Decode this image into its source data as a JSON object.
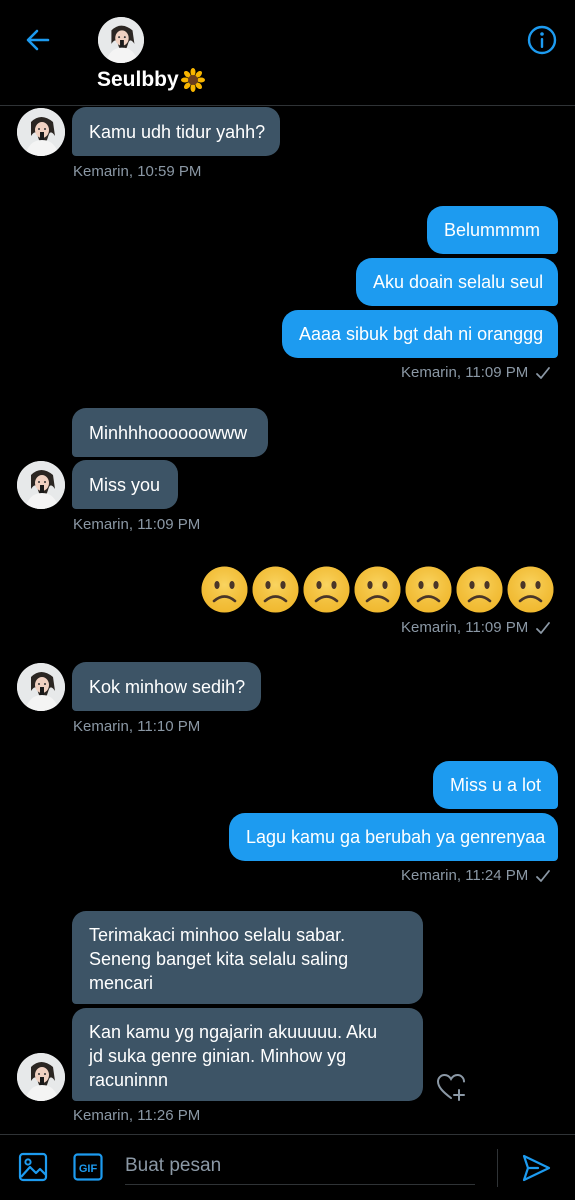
{
  "header": {
    "name": "Seulbby",
    "icons": {
      "back": "arrow-left-icon",
      "info": "info-icon",
      "name_emoji": "sunflower-emoji"
    }
  },
  "messages": {
    "m1": {
      "text": "Kamu udh tidur yahh?",
      "time": "Kemarin, 10:59 PM"
    },
    "m2": {
      "text": "Belummmm"
    },
    "m3": {
      "text": "Aku doain selalu seul"
    },
    "m4": {
      "text": "Aaaa sibuk bgt dah ni oranggg",
      "time": "Kemarin, 11:09 PM"
    },
    "m5": {
      "text": "Minhhhoooooowww"
    },
    "m6": {
      "text": "Miss you",
      "time": "Kemarin, 11:09 PM"
    },
    "m7": {
      "emoji": "slightly-frowning-face",
      "count": 7,
      "time": "Kemarin, 11:09 PM"
    },
    "m8": {
      "text": "Kok minhow sedih?",
      "time": "Kemarin, 11:10 PM"
    },
    "m9": {
      "text": "Miss u a lot"
    },
    "m10": {
      "text": "Lagu kamu ga berubah ya genrenyaa",
      "time": "Kemarin, 11:24 PM"
    },
    "m11": {
      "lines": [
        "Terimakaci minhoo selalu sabar.",
        "Seneng banget kita selalu saling",
        "mencari"
      ]
    },
    "m12": {
      "lines": [
        "Kan kamu yg ngajarin akuuuuu. Aku",
        "jd suka genre ginian. Minhow yg",
        "racuninnn"
      ],
      "time": "Kemarin, 11:26 PM"
    }
  },
  "composer": {
    "placeholder": "Buat pesan",
    "gif_label": "GIF"
  },
  "colors": {
    "background": "#000000",
    "incoming_bubble": "#3d5466",
    "outgoing_bubble": "#1d9bf0",
    "accent": "#1d9bf0",
    "meta_text": "#8b98a5"
  }
}
